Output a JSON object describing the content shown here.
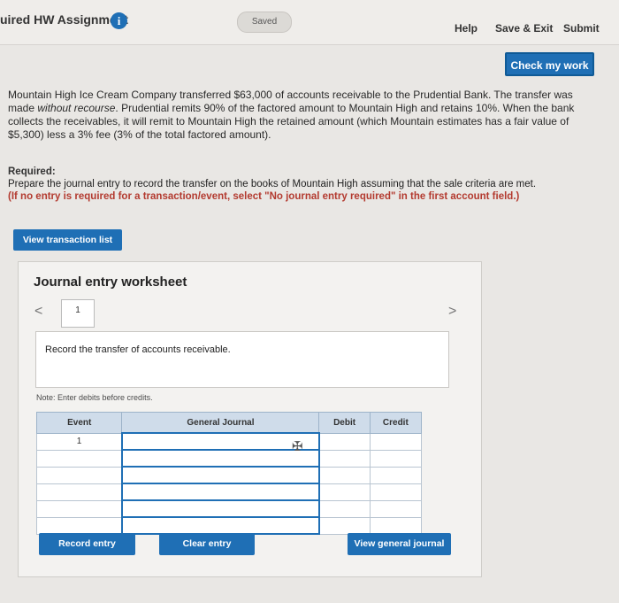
{
  "header": {
    "title": "uired HW Assignment",
    "info_icon": "i",
    "saved": "Saved",
    "help": "Help",
    "save_exit": "Save & Exit",
    "submit": "Submit",
    "check_work": "Check my work"
  },
  "problem": {
    "p1": "Mountain High Ice Cream Company transferred $63,000 of accounts receivable to the Prudential Bank. The transfer was made ",
    "p_italic": "without recourse",
    "p2": ". Prudential remits 90% of the factored amount to Mountain High and retains 10%. When the bank collects the receivables, it will remit to Mountain High the retained amount (which Mountain estimates has a fair value of $5,300) less a 3% fee (3% of the total factored amount).",
    "required_label": "Required:",
    "required_text": "Prepare the journal entry to record the transfer on the books of Mountain High assuming that the sale criteria are met.",
    "required_note": "(If no entry is required for a transaction/event, select \"No journal entry required\" in the first account field.)"
  },
  "buttons": {
    "view_transaction_list": "View transaction list",
    "record_entry": "Record entry",
    "clear_entry": "Clear entry",
    "view_general_journal": "View general journal"
  },
  "worksheet": {
    "title": "Journal entry worksheet",
    "prev": "<",
    "next": ">",
    "page": "1",
    "description": "Record the transfer of accounts receivable.",
    "note": "Note: Enter debits before credits.",
    "columns": [
      "Event",
      "General Journal",
      "Debit",
      "Credit"
    ],
    "rows": [
      {
        "event": "1",
        "account": "",
        "debit": "",
        "credit": ""
      },
      {
        "event": "",
        "account": "",
        "debit": "",
        "credit": ""
      },
      {
        "event": "",
        "account": "",
        "debit": "",
        "credit": ""
      },
      {
        "event": "",
        "account": "",
        "debit": "",
        "credit": ""
      },
      {
        "event": "",
        "account": "",
        "debit": "",
        "credit": ""
      },
      {
        "event": "",
        "account": "",
        "debit": "",
        "credit": ""
      }
    ]
  },
  "colors": {
    "accent": "#1f6fb5",
    "warning": "#b33a2f"
  }
}
